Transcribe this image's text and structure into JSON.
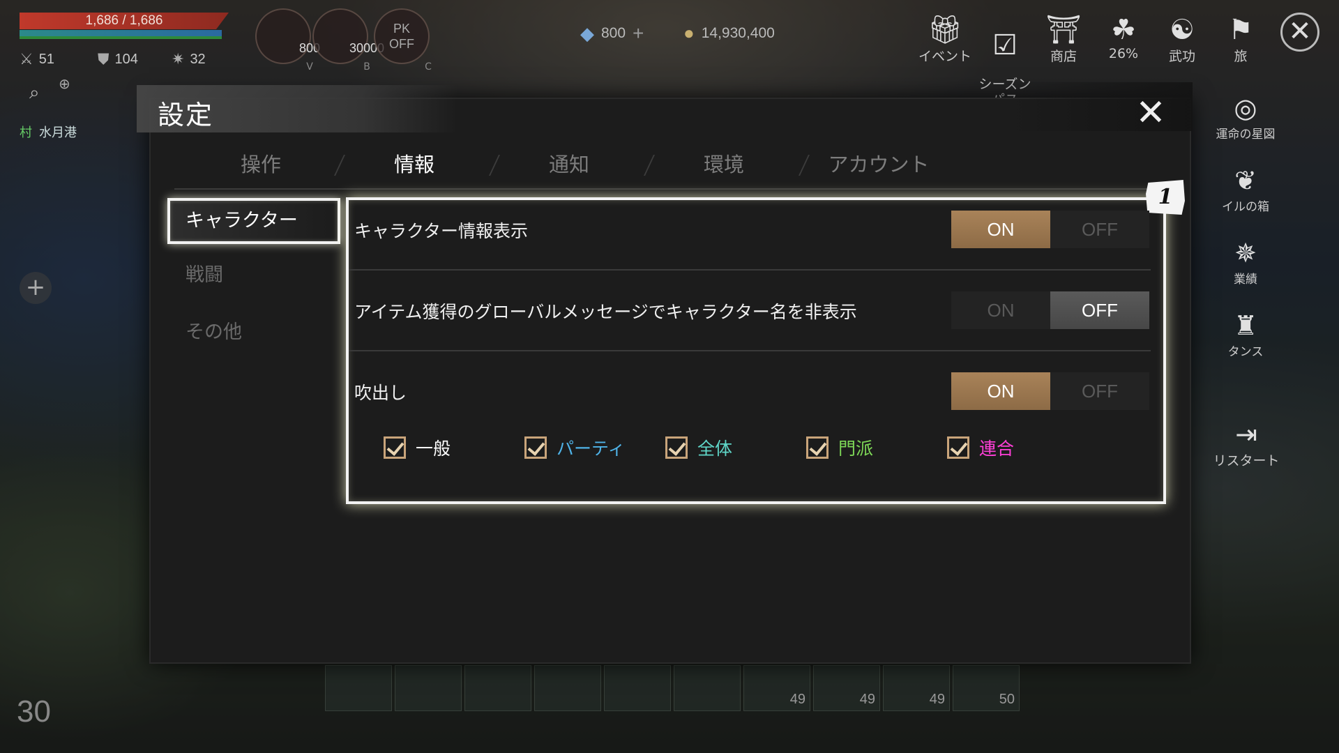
{
  "hud": {
    "hp_text": "1,686 / 1,686",
    "stats": [
      {
        "icon": "swords-icon",
        "value": "51"
      },
      {
        "icon": "shield-icon",
        "value": "104"
      },
      {
        "icon": "star-icon",
        "value": "32"
      }
    ],
    "potion": {
      "value": "800",
      "key": "V"
    },
    "skill": {
      "value": "30000",
      "key": "B"
    },
    "pk": {
      "label_line1": "PK",
      "label_line2": "OFF",
      "key": "C"
    },
    "gems": "800",
    "gold": "14,930,400",
    "location_tag": "村",
    "location": "水月港",
    "level": "30"
  },
  "top_menu": [
    {
      "label": "イベント"
    },
    {
      "label": "シーズン\nパス"
    },
    {
      "label": "商店"
    },
    {
      "label": "26%"
    },
    {
      "label": "武功"
    },
    {
      "label": "旅"
    }
  ],
  "side_menu": [
    {
      "label": "運命の星図"
    },
    {
      "label": "イルの箱"
    },
    {
      "label": "業績"
    },
    {
      "label": "タンス"
    },
    {
      "label": "リスタート"
    }
  ],
  "hotbar": {
    "counts": [
      "",
      "",
      "",
      "",
      "",
      "",
      "49",
      "49",
      "49",
      "50"
    ]
  },
  "dialog": {
    "title": "設定",
    "tabs": [
      "操作",
      "情報",
      "通知",
      "環境",
      "アカウント"
    ],
    "active_tab": 1,
    "sidenav": [
      "キャラクター",
      "戦闘",
      "その他"
    ],
    "marker": "1",
    "rows": [
      {
        "label": "キャラクター情報表示",
        "on": "ON",
        "off": "OFF",
        "value": "ON"
      },
      {
        "label": "アイテム獲得のグローバルメッセージでキャラクター名を非表示",
        "on": "ON",
        "off": "OFF",
        "value": "OFF"
      },
      {
        "label": "吹出し",
        "on": "ON",
        "off": "OFF",
        "value": "ON"
      }
    ],
    "checkboxes": [
      {
        "label": "一般",
        "checked": true,
        "color": "#ffffff"
      },
      {
        "label": "パーティ",
        "checked": true,
        "color": "#4fb3e8"
      },
      {
        "label": "全体",
        "checked": true,
        "color": "#5fd6c8"
      },
      {
        "label": "門派",
        "checked": true,
        "color": "#7ed957"
      },
      {
        "label": "連合",
        "checked": true,
        "color": "#ff3fd8"
      }
    ]
  },
  "colors": {
    "accent_on": "#a98359",
    "panel_highlight": "#f2f2f2"
  }
}
